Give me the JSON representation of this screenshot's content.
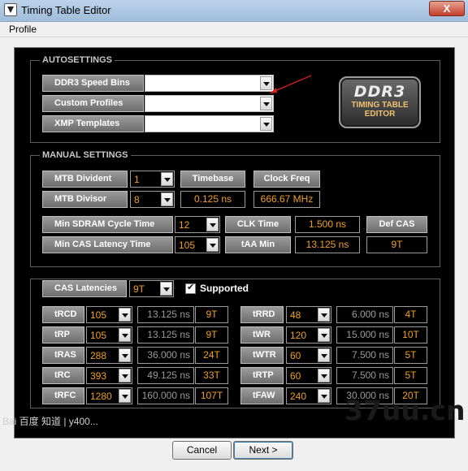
{
  "window": {
    "title": "Timing Table Editor",
    "close": "X"
  },
  "menu": {
    "profile": "Profile"
  },
  "autosettings": {
    "title": "AUTOSETTINGS",
    "ddr3_speed_bins": "DDR3 Speed Bins",
    "custom_profiles": "Custom Profiles",
    "xmp_templates": "XMP Templates"
  },
  "logo": {
    "line1": "DDR3",
    "line2": "TIMING TABLE",
    "line3": "EDITOR"
  },
  "manual": {
    "title": "MANUAL SETTINGS",
    "mtb_divident_label": "MTB Divident",
    "mtb_divident_value": "1",
    "mtb_divisor_label": "MTB Divisor",
    "mtb_divisor_value": "8",
    "timebase_label": "Timebase",
    "timebase_value": "0.125 ns",
    "clock_freq_label": "Clock Freq",
    "clock_freq_value": "666.67 MHz",
    "min_sdram_label": "Min SDRAM Cycle Time",
    "min_sdram_value": "12",
    "clk_time_label": "CLK Time",
    "clk_time_value": "1.500 ns",
    "def_cas_label": "Def CAS",
    "min_cas_label": "Min CAS Latency Time",
    "min_cas_value": "105",
    "taa_min_label": "tAA Min",
    "taa_min_value": "13.125 ns",
    "def_cas_value": "9T"
  },
  "timings": {
    "cas_latencies_label": "CAS Latencies",
    "cas_latencies_value": "9T",
    "supported_label": "Supported",
    "left": [
      {
        "label": "tRCD",
        "value": "105",
        "ns": "13.125 ns",
        "t": "9T"
      },
      {
        "label": "tRP",
        "value": "105",
        "ns": "13.125 ns",
        "t": "9T"
      },
      {
        "label": "tRAS",
        "value": "288",
        "ns": "36.000 ns",
        "t": "24T"
      },
      {
        "label": "tRC",
        "value": "393",
        "ns": "49.125 ns",
        "t": "33T"
      },
      {
        "label": "tRFC",
        "value": "1280",
        "ns": "160.000 ns",
        "t": "107T"
      }
    ],
    "right": [
      {
        "label": "tRRD",
        "value": "48",
        "ns": "6.000 ns",
        "t": "4T"
      },
      {
        "label": "tWR",
        "value": "120",
        "ns": "15.000 ns",
        "t": "10T"
      },
      {
        "label": "tWTR",
        "value": "60",
        "ns": "7.500 ns",
        "t": "5T"
      },
      {
        "label": "tRTP",
        "value": "60",
        "ns": "7.500 ns",
        "t": "5T"
      },
      {
        "label": "tFAW",
        "value": "240",
        "ns": "30.000 ns",
        "t": "20T"
      }
    ]
  },
  "buttons": {
    "cancel": "Cancel",
    "next": "Next >"
  },
  "watermarks": {
    "left": "Bai 百度 知道 | y400... ",
    "right": "37uu.cn"
  },
  "colors": {
    "value_text": "#f0a020",
    "panel_bg": "#000000",
    "titlebar": "#a8c3de"
  }
}
